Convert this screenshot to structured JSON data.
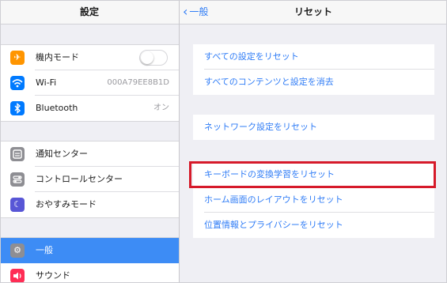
{
  "left_pane": {
    "title": "設定",
    "group1": [
      {
        "label": "機内モード",
        "icon": "airplane-icon",
        "icon_color": "#ff9500",
        "toggle": "off"
      },
      {
        "label": "Wi-Fi",
        "icon": "wifi-icon",
        "icon_color": "#007aff",
        "value": "000A79EE8B1D"
      },
      {
        "label": "Bluetooth",
        "icon": "bluetooth-icon",
        "icon_color": "#007aff",
        "value": "オン"
      }
    ],
    "group2": [
      {
        "label": "通知センター",
        "icon": "notification-center-icon",
        "icon_color": "#8e8e93"
      },
      {
        "label": "コントロールセンター",
        "icon": "control-center-icon",
        "icon_color": "#8e8e93"
      },
      {
        "label": "おやすみモード",
        "icon": "moon-icon",
        "icon_color": "#5856d6"
      }
    ],
    "group3": [
      {
        "label": "一般",
        "icon": "gear-icon",
        "icon_color": "#8e8e93",
        "selected": true
      },
      {
        "label": "サウンド",
        "icon": "speaker-icon",
        "icon_color": "#ff2d55"
      }
    ]
  },
  "right_pane": {
    "back_label": "一般",
    "title": "リセット",
    "group1": [
      "すべての設定をリセット",
      "すべてのコンテンツと設定を消去"
    ],
    "group2": [
      "ネットワーク設定をリセット"
    ],
    "group3": [
      "キーボードの変換学習をリセット",
      "ホーム画面のレイアウトをリセット",
      "位置情報とプライバシーをリセット"
    ],
    "highlighted_item": "キーボードの変換学習をリセット",
    "highlight_color": "#d61a2a",
    "accent_color": "#2f7cf6"
  }
}
